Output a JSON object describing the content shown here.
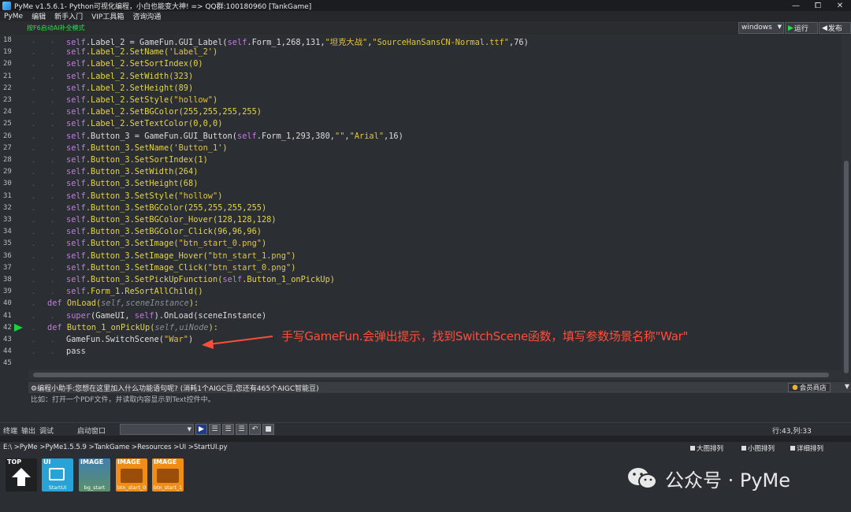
{
  "window": {
    "title": "PyMe v1.5.6.1- Python可视化编程，小白也能变大神!   => QQ群:100180960   [TankGame]",
    "controls": [
      "—",
      "⧠",
      "✕"
    ]
  },
  "menu": [
    "PyMe",
    "编辑",
    "新手入门",
    "VIP工具箱",
    "咨询沟通"
  ],
  "toolbar": {
    "hint": "按F6启动AI补全模式",
    "platform": "windows",
    "run_label": "运行",
    "publish_label": "发布"
  },
  "editor": {
    "lines": [
      {
        "n": "18",
        "indent": 2,
        "segments": [
          [
            "self",
            "self"
          ],
          [
            "plain",
            ".Label_2 = GameFun.GUI_Label("
          ],
          [
            "self",
            "self"
          ],
          [
            "plain",
            ".Form_1,268,131,"
          ],
          [
            "str",
            "\"坦克大战\""
          ],
          [
            "plain",
            ","
          ],
          [
            "str",
            "\"SourceHanSansCN-Normal.ttf\""
          ],
          [
            "plain",
            ",76)"
          ]
        ]
      },
      {
        "n": "19",
        "indent": 2,
        "segments": [
          [
            "self",
            "self"
          ],
          [
            "method",
            ".Label_2.SetName("
          ],
          [
            "str",
            "'Label_2'"
          ],
          [
            "method",
            ")"
          ]
        ]
      },
      {
        "n": "20",
        "indent": 2,
        "segments": [
          [
            "self",
            "self"
          ],
          [
            "method",
            ".Label_2.SetSortIndex(0)"
          ]
        ]
      },
      {
        "n": "21",
        "indent": 2,
        "segments": [
          [
            "self",
            "self"
          ],
          [
            "method",
            ".Label_2.SetWidth(323)"
          ]
        ]
      },
      {
        "n": "22",
        "indent": 2,
        "segments": [
          [
            "self",
            "self"
          ],
          [
            "method",
            ".Label_2.SetHeight(89)"
          ]
        ]
      },
      {
        "n": "23",
        "indent": 2,
        "segments": [
          [
            "self",
            "self"
          ],
          [
            "method",
            ".Label_2.SetStyle("
          ],
          [
            "str",
            "\"hollow\""
          ],
          [
            "method",
            ")"
          ]
        ]
      },
      {
        "n": "24",
        "indent": 2,
        "segments": [
          [
            "self",
            "self"
          ],
          [
            "method",
            ".Label_2.SetBGColor(255,255,255,255)"
          ]
        ]
      },
      {
        "n": "25",
        "indent": 2,
        "segments": [
          [
            "self",
            "self"
          ],
          [
            "method",
            ".Label_2.SetTextColor(0,0,0)"
          ]
        ]
      },
      {
        "n": "26",
        "indent": 2,
        "segments": [
          [
            "self",
            "self"
          ],
          [
            "plain",
            ".Button_3 = GameFun.GUI_Button("
          ],
          [
            "self",
            "self"
          ],
          [
            "plain",
            ".Form_1,293,380,"
          ],
          [
            "str",
            "\"\""
          ],
          [
            "plain",
            ","
          ],
          [
            "str",
            "\"Arial\""
          ],
          [
            "plain",
            ",16)"
          ]
        ]
      },
      {
        "n": "27",
        "indent": 2,
        "segments": [
          [
            "self",
            "self"
          ],
          [
            "method",
            ".Button_3.SetName("
          ],
          [
            "str",
            "'Button_1'"
          ],
          [
            "method",
            ")"
          ]
        ]
      },
      {
        "n": "28",
        "indent": 2,
        "segments": [
          [
            "self",
            "self"
          ],
          [
            "method",
            ".Button_3.SetSortIndex(1)"
          ]
        ]
      },
      {
        "n": "29",
        "indent": 2,
        "segments": [
          [
            "self",
            "self"
          ],
          [
            "method",
            ".Button_3.SetWidth(264)"
          ]
        ]
      },
      {
        "n": "30",
        "indent": 2,
        "segments": [
          [
            "self",
            "self"
          ],
          [
            "method",
            ".Button_3.SetHeight(68)"
          ]
        ]
      },
      {
        "n": "31",
        "indent": 2,
        "segments": [
          [
            "self",
            "self"
          ],
          [
            "method",
            ".Button_3.SetStyle("
          ],
          [
            "str",
            "\"hollow\""
          ],
          [
            "method",
            ")"
          ]
        ]
      },
      {
        "n": "32",
        "indent": 2,
        "segments": [
          [
            "self",
            "self"
          ],
          [
            "method",
            ".Button_3.SetBGColor(255,255,255,255)"
          ]
        ]
      },
      {
        "n": "33",
        "indent": 2,
        "segments": [
          [
            "self",
            "self"
          ],
          [
            "method",
            ".Button_3.SetBGColor_Hover(128,128,128)"
          ]
        ]
      },
      {
        "n": "34",
        "indent": 2,
        "segments": [
          [
            "self",
            "self"
          ],
          [
            "method",
            ".Button_3.SetBGColor_Click(96,96,96)"
          ]
        ]
      },
      {
        "n": "35",
        "indent": 2,
        "segments": [
          [
            "self",
            "self"
          ],
          [
            "method",
            ".Button_3.SetImage("
          ],
          [
            "str",
            "\"btn_start_0.png\""
          ],
          [
            "method",
            ")"
          ]
        ]
      },
      {
        "n": "36",
        "indent": 2,
        "segments": [
          [
            "self",
            "self"
          ],
          [
            "method",
            ".Button_3.SetImage_Hover("
          ],
          [
            "str",
            "\"btn_start_1.png\""
          ],
          [
            "method",
            ")"
          ]
        ]
      },
      {
        "n": "37",
        "indent": 2,
        "segments": [
          [
            "self",
            "self"
          ],
          [
            "method",
            ".Button_3.SetImage_Click("
          ],
          [
            "str",
            "\"btn_start_0.png\""
          ],
          [
            "method",
            ")"
          ]
        ]
      },
      {
        "n": "38",
        "indent": 2,
        "segments": [
          [
            "self",
            "self"
          ],
          [
            "method",
            ".Button_3.SetPickUpFunction("
          ],
          [
            "self",
            "self"
          ],
          [
            "method",
            ".Button_1_onPickUp)"
          ]
        ]
      },
      {
        "n": "39",
        "indent": 2,
        "segments": [
          [
            "self",
            "self"
          ],
          [
            "method",
            ".Form_1.ReSortAllChild()"
          ]
        ]
      },
      {
        "n": "40",
        "indent": 1,
        "segments": [
          [
            "kw",
            "def "
          ],
          [
            "def",
            "OnLoad("
          ],
          [
            "param",
            "self,sceneInstance"
          ],
          [
            "def",
            "):"
          ]
        ]
      },
      {
        "n": "41",
        "indent": 2,
        "segments": [
          [
            "kw",
            "super"
          ],
          [
            "plain",
            "(GameUI, "
          ],
          [
            "self",
            "self"
          ],
          [
            "plain",
            ").OnLoad(sceneInstance)"
          ]
        ]
      },
      {
        "n": "42",
        "indent": 1,
        "segments": [
          [
            "kw",
            "def "
          ],
          [
            "def",
            "Button_1_onPickUp("
          ],
          [
            "param",
            "self,uiNode"
          ],
          [
            "def",
            "):"
          ]
        ]
      },
      {
        "n": "43",
        "indent": 2,
        "segments": [
          [
            "plain",
            "GameFun.SwitchScene("
          ],
          [
            "str",
            "\"War\""
          ],
          [
            "plain",
            ")"
          ]
        ]
      },
      {
        "n": "44",
        "indent": 2,
        "segments": [
          [
            "plain",
            "pass"
          ]
        ]
      },
      {
        "n": "45",
        "indent": 0,
        "segments": []
      }
    ],
    "run_marker_line": "42"
  },
  "annotation": {
    "text": "手写GameFun.会弹出提示，找到SwitchScene函数，填写参数场景名称\"War\"",
    "color": "#ff4d3a"
  },
  "assistant": {
    "text": "编程小助手:您想在这里加入什么功能语句呢? (消耗1个AIGC豆,您还有465个AIGC智能豆)",
    "member_label": "会员商店",
    "placeholder": "比如：打开一个PDF文件，并读取内容显示到Text控件中。"
  },
  "console": {
    "tabs": [
      "终端",
      "输出",
      "调试"
    ],
    "start_window": "启动窗口",
    "cursor_pos": "行:43,列:33"
  },
  "resources": {
    "path": "E:\\ >PyMe >PyMe1.5.5.9 >TankGame >Resources >UI >StartUI.py",
    "view_options": [
      "大图排列",
      "小图排列",
      "详细排列"
    ],
    "items": [
      {
        "type": "TOP",
        "name": ""
      },
      {
        "type": "UI",
        "name": "StartUI"
      },
      {
        "type": "IMAGE",
        "name": "bg_start"
      },
      {
        "type": "IMAGE",
        "name": "btn_start_0"
      },
      {
        "type": "IMAGE",
        "name": "btn_start_1"
      }
    ]
  },
  "watermark": "公众号 · PyMe",
  "colors": {
    "self": "#c27adf",
    "method": "#e3d44b",
    "string": "#e0c340",
    "hint_green": "#27e046",
    "run_marker": "#19d13a"
  }
}
